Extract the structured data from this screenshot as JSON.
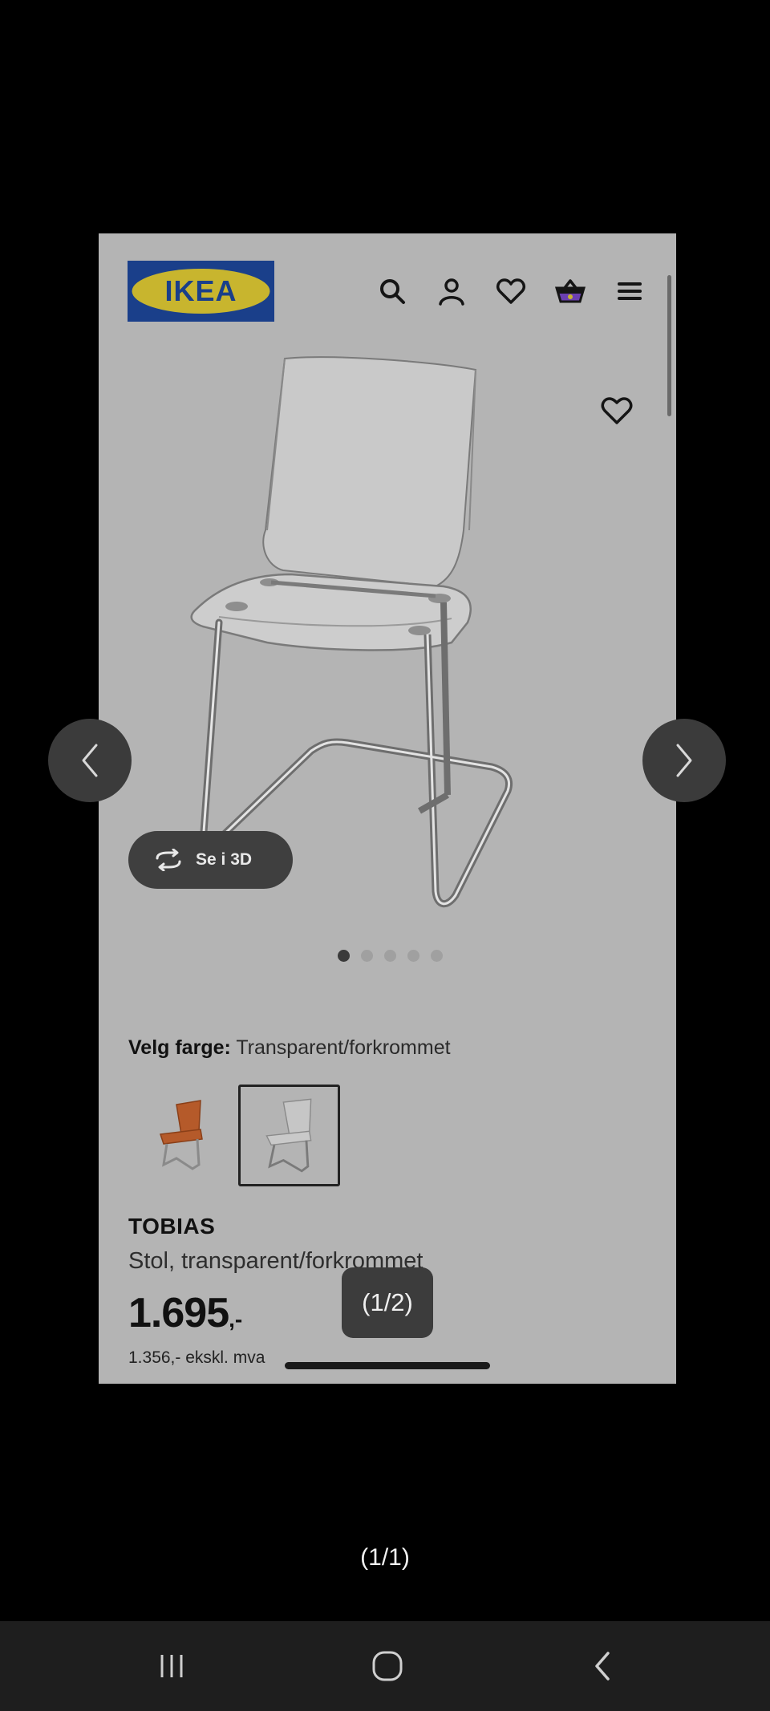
{
  "site": {
    "logo_text": "IKEA",
    "nav_icons": [
      "search-icon",
      "account-icon",
      "heart-icon",
      "basket-icon",
      "menu-icon"
    ]
  },
  "product": {
    "view_3d_label": "Se i 3D",
    "image_count": 5,
    "active_image": 1,
    "color_label": "Velg farge:",
    "color_value": "Transparent/forkrommet",
    "swatches": [
      "orange-chair-swatch",
      "transparent-chair-swatch"
    ],
    "selected_swatch": 2,
    "name": "TOBIAS",
    "description": "Stol, transparent/forkrommet",
    "price_main": "1.695",
    "price_suffix": ",-",
    "price_ex_vat": "1.356,- ekskl. mva"
  },
  "viewer": {
    "inner_counter": "(1/2)",
    "outer_counter": "(1/1)"
  },
  "colors": {
    "background": "#000000",
    "screenshot_dimmed": "#b4b4b4",
    "ikea_blue": "#1a3f8a",
    "ikea_yellow": "#c8b52e",
    "system_nav": "#1e1e1e"
  }
}
